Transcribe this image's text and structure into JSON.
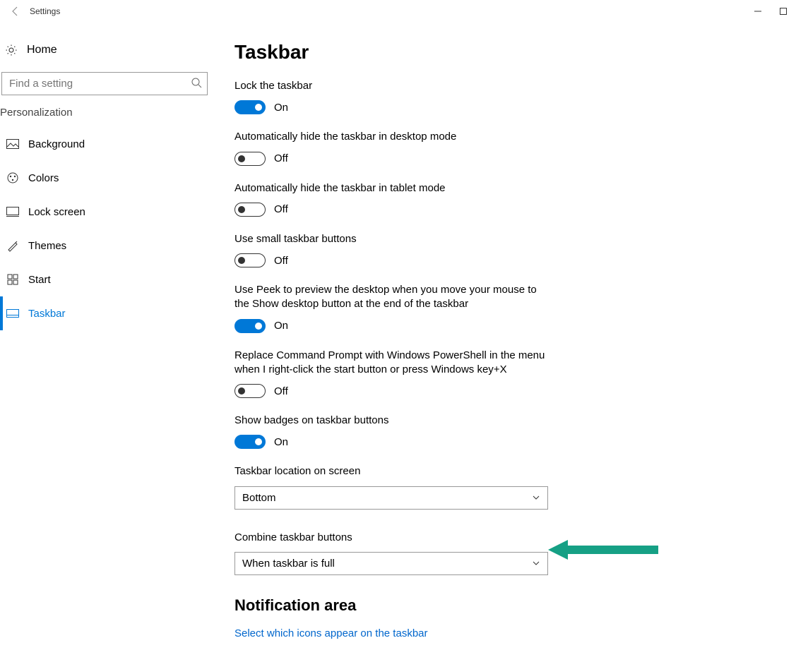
{
  "window": {
    "title": "Settings"
  },
  "sidebar": {
    "home": "Home",
    "search_placeholder": "Find a setting",
    "category": "Personalization",
    "items": [
      {
        "label": "Background"
      },
      {
        "label": "Colors"
      },
      {
        "label": "Lock screen"
      },
      {
        "label": "Themes"
      },
      {
        "label": "Start"
      },
      {
        "label": "Taskbar"
      }
    ]
  },
  "page": {
    "heading": "Taskbar",
    "on_text": "On",
    "off_text": "Off",
    "lock_label": "Lock the taskbar",
    "autohide_desktop_label": "Automatically hide the taskbar in desktop mode",
    "autohide_tablet_label": "Automatically hide the taskbar in tablet mode",
    "small_buttons_label": "Use small taskbar buttons",
    "peek_label": "Use Peek to preview the desktop when you move your mouse to the Show desktop button at the end of the taskbar",
    "powershell_label": "Replace Command Prompt with Windows PowerShell in the menu when I right-click the start button or press Windows key+X",
    "badges_label": "Show badges on taskbar buttons",
    "location_label": "Taskbar location on screen",
    "location_value": "Bottom",
    "combine_label": "Combine taskbar buttons",
    "combine_value": "When taskbar is full",
    "notif_heading": "Notification area",
    "notif_link": "Select which icons appear on the taskbar"
  }
}
